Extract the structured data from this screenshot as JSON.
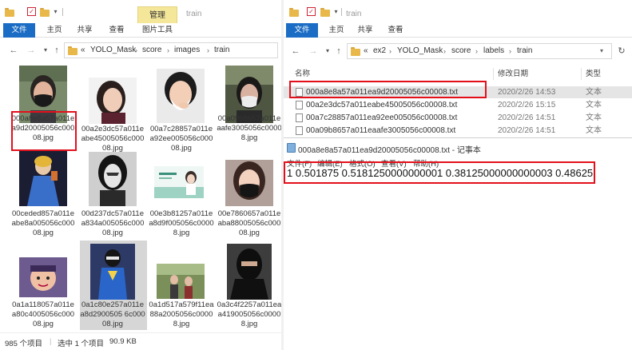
{
  "left_window": {
    "title_dim": "train",
    "contextual_tab": "管理",
    "ribbon_tabs": [
      "文件",
      "主页",
      "共享",
      "查看",
      "图片工具"
    ],
    "breadcrumb": [
      "«",
      "YOLO_Mask",
      "score",
      "images",
      "train"
    ],
    "thumbnails": [
      {
        "label": "000a8e8a57a011ea9d20005056c00008.jpg",
        "scene": "mask-woman"
      },
      {
        "label": "00a2e3dc57a011eabe45005056c00008.jpg",
        "scene": "dark-hair-woman"
      },
      {
        "label": "00a7c28857a011ea92ee005056c00008.jpg",
        "scene": "hand-on-face"
      },
      {
        "label": "00a09b8657a011eaafe3005056c00008.jpg",
        "scene": "mask-outdoor"
      },
      {
        "label": "00ceded857a011eabe8a005056c00008.jpg",
        "scene": "cartoon-princess"
      },
      {
        "label": "00d237dc57a011ea834a005056c00008.jpg",
        "scene": "bw-portrait"
      },
      {
        "label": "00e3b81257a011ea8d9f005056c00008.jpg",
        "scene": "product-banner"
      },
      {
        "label": "00e7860657a011eaba88005056c00008.jpg",
        "scene": "black-mask"
      },
      {
        "label": "0a1a118057a011ea80c4005056c00008.jpg",
        "scene": "cartoon-kid"
      },
      {
        "label": "0a1c80e257a011ea8d2900505 6c00008.jpg",
        "scene": "superhero"
      },
      {
        "label": "0a1d517a579f11ea88a2005056c00008.jpg",
        "scene": "outdoor-people"
      },
      {
        "label": "0a3c4f2257a011eaa419005056c00008.jpg",
        "scene": "ninja"
      }
    ],
    "status": {
      "count": "985 个项目",
      "selected": "选中 1 个项目",
      "size": "90.9 KB"
    }
  },
  "right_window": {
    "title_dim": "train",
    "ribbon_tabs": [
      "文件",
      "主页",
      "共享",
      "查看"
    ],
    "breadcrumb": [
      "«",
      "ex2",
      "YOLO_Mask",
      "score",
      "labels",
      "train"
    ],
    "refresh_icon": "↻",
    "columns": {
      "name": "名称",
      "date": "修改日期",
      "type": "类型"
    },
    "files": [
      {
        "name": "000a8e8a57a011ea9d20005056c00008.txt",
        "date": "2020/2/26 14:53",
        "type": "文本"
      },
      {
        "name": "00a2e3dc57a011eabe45005056c00008.txt",
        "date": "2020/2/26 15:15",
        "type": "文本"
      },
      {
        "name": "00a7c28857a011ea92ee005056c00008.txt",
        "date": "2020/2/26 14:51",
        "type": "文本"
      },
      {
        "name": "00a09b8657a011eaafe3005056c00008.txt",
        "date": "2020/2/26 14:51",
        "type": "文本"
      }
    ],
    "notepad": {
      "title": "000a8e8a57a011ea9d20005056c00008.txt - 记事本",
      "menu": [
        "文件(F)",
        "编辑(E)",
        "格式(O)",
        "查看(V)",
        "帮助(H)"
      ],
      "content": "1 0.501875 0.5181250000000001 0.38125000000000003 0.48625"
    }
  },
  "colors": {
    "highlight_red": "#e3101c",
    "ribbon_blue": "#1b6cc4",
    "manage_yellow": "#f5e79a"
  }
}
